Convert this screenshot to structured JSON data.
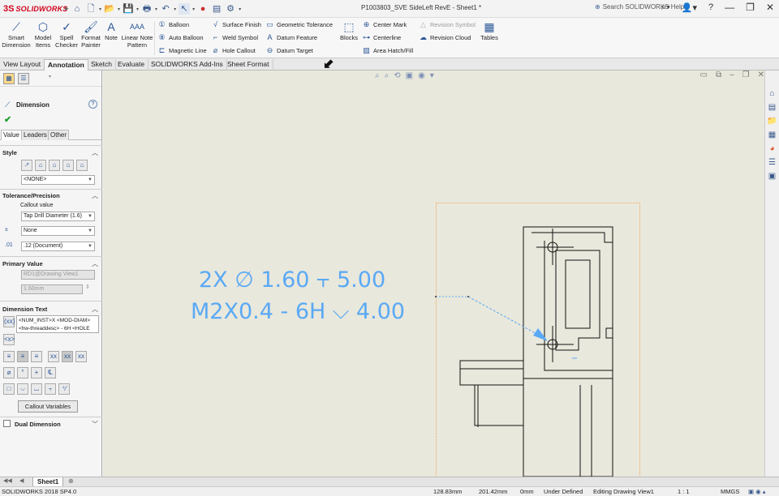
{
  "app": {
    "logo_mark": "3S",
    "logo_text": "SOLIDWORKS",
    "document_title": "P1003803_SVE SideLeft RevE - Sheet1 *"
  },
  "quick_access": {
    "icons": [
      "home-icon",
      "new-icon",
      "open-icon",
      "save-icon",
      "print-icon",
      "undo-icon",
      "select-icon",
      "rebuild-icon",
      "options-icon"
    ]
  },
  "help": {
    "search_label": "Search SOLIDWORKS Help"
  },
  "window_buttons": {
    "question": "?",
    "minimize": "—",
    "restore": "❐",
    "close": "✕"
  },
  "ribbon": {
    "smart_dimension": "Smart\nDimension",
    "model_items": "Model\nItems",
    "spell_checker": "Spell\nChecker",
    "format_painter": "Format\nPainter",
    "note": "Note",
    "linear_note_pattern": "Linear Note\nPattern",
    "balloon": "Balloon",
    "auto_balloon": "Auto Balloon",
    "magnetic_line": "Magnetic Line",
    "surface_finish": "Surface Finish",
    "weld_symbol": "Weld Symbol",
    "hole_callout": "Hole Callout",
    "geometric_tolerance": "Geometric Tolerance",
    "datum_feature": "Datum Feature",
    "datum_target": "Datum Target",
    "blocks": "Blocks",
    "center_mark": "Center Mark",
    "centerline": "Centerline",
    "area_hatch": "Area Hatch/Fill",
    "revision_symbol": "Revision Symbol",
    "revision_cloud": "Revision Cloud",
    "tables": "Tables"
  },
  "tabs": [
    "View Layout",
    "Annotation",
    "Sketch",
    "Evaluate",
    "SOLIDWORKS Add-Ins",
    "Sheet Format"
  ],
  "active_tab": "Annotation",
  "property_manager": {
    "title": "Dimension",
    "help": "?",
    "ok": "✔",
    "subtabs": [
      "Value",
      "Leaders",
      "Other"
    ],
    "style": {
      "header": "Style",
      "value": "<NONE>"
    },
    "tolerance": {
      "header": "Tolerance/Precision",
      "callout_label": "Callout value",
      "callout_value": "Tap Drill Diameter (1.6)",
      "tolerance_type": "None",
      "precision": ".12 (Document)"
    },
    "primary_value": {
      "header": "Primary Value",
      "reference": "RD1@Drawing View1",
      "value": "1.60mm"
    },
    "dimension_text": {
      "header": "Dimension Text",
      "line1": "<NUM_INST>X <MOD-DIAM>",
      "line2": "<hw-threaddesc> - 6H <HOLE"
    },
    "callout_variables": "Callout Variables",
    "dual_dimension": "Dual Dimension"
  },
  "drawing": {
    "callout_line1": "2X  ∅  1.60  ⫟  5.00",
    "callout_line2": "M2X0.4 - 6H  ⌵  4.00"
  },
  "sheet_tab": "Sheet1",
  "status": {
    "version": "SOLIDWORKS 2018 SP4.0",
    "x": "128.83mm",
    "y": "201.42mm",
    "z": "0mm",
    "definition": "Under Defined",
    "mode": "Editing Drawing View1",
    "scale": "1 : 1",
    "units": "MMGS"
  },
  "colors": {
    "dimension_blue": "#5aa9f5",
    "canvas": "#e9e8dc",
    "logo_red": "#d0021b"
  }
}
